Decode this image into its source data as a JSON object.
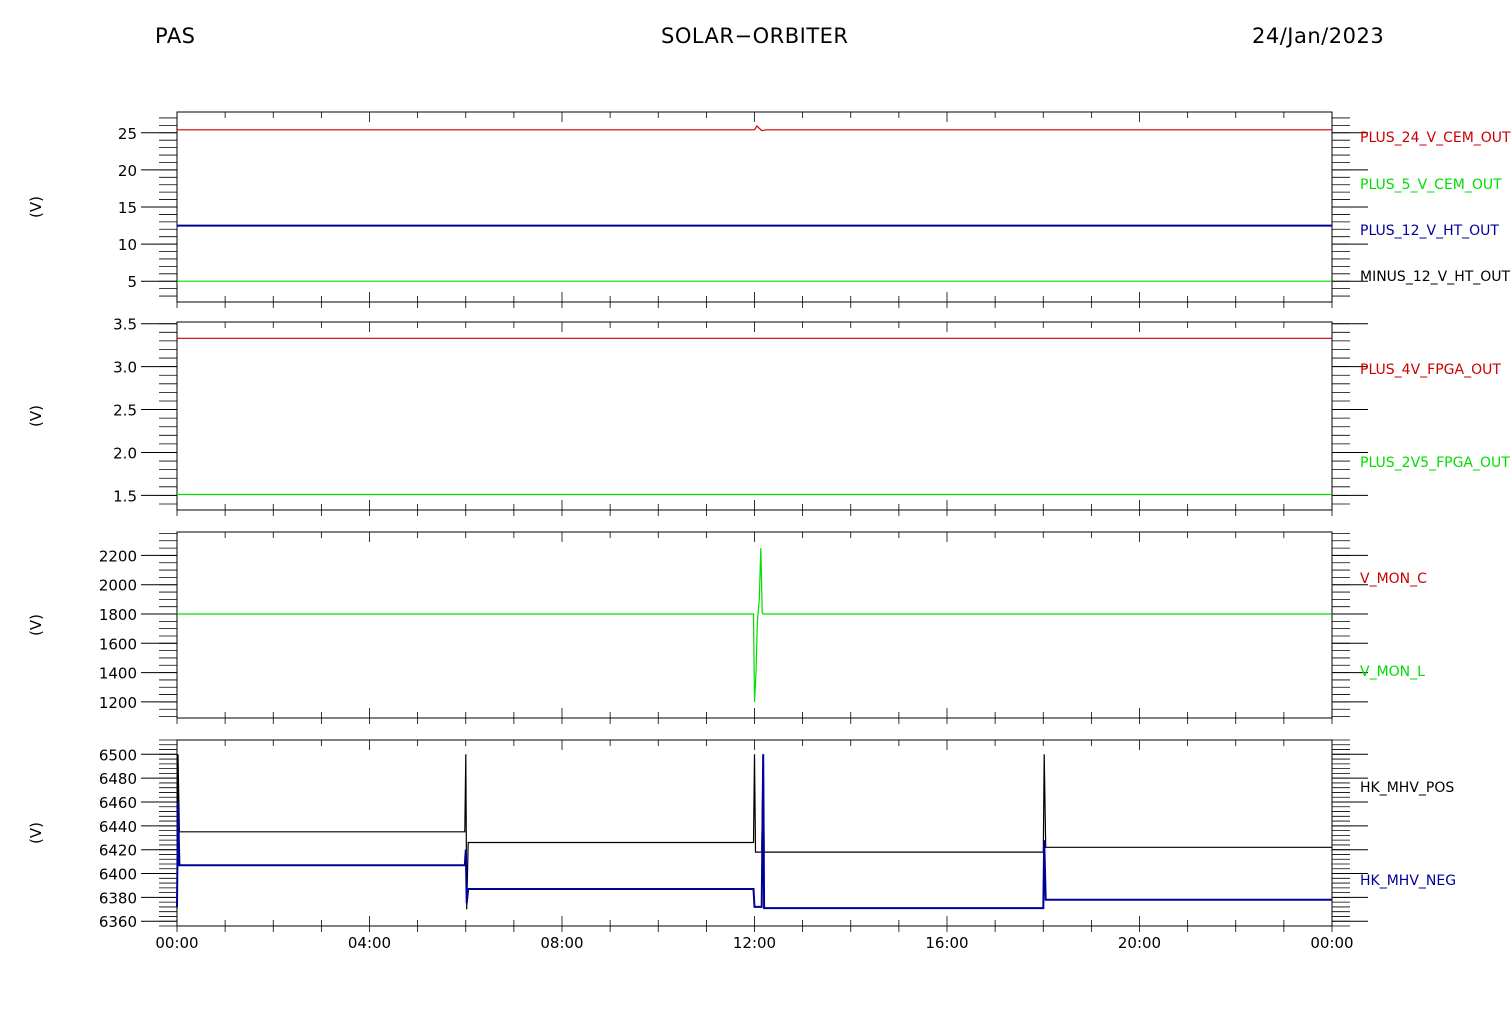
{
  "header": {
    "left": "PAS",
    "center": "SOLAR−ORBITER",
    "right": "24/Jan/2023"
  },
  "colors": {
    "red": "#cc0000",
    "green": "#00dd00",
    "blue": "#000099",
    "black": "#000000"
  },
  "chart_data": [
    {
      "type": "line",
      "ylabel": "(V)",
      "ylim": [
        2.2,
        27.8
      ],
      "yticks": [
        5,
        10,
        15,
        20,
        25
      ],
      "yminor": 1,
      "xlim": [
        0,
        24
      ],
      "series": [
        {
          "name": "PLUS_24_V_CEM_OUT",
          "color": "#cc0000",
          "x": [
            0,
            12.0,
            12.05,
            12.1,
            12.15,
            12.25,
            24
          ],
          "y": [
            25.4,
            25.4,
            25.9,
            25.6,
            25.3,
            25.4,
            25.4
          ]
        },
        {
          "name": "PLUS_5_V_CEM_OUT",
          "color": "#00dd00",
          "x": [
            0,
            24
          ],
          "y": [
            5.0,
            5.0
          ]
        },
        {
          "name": "PLUS_12_V_HT_OUT",
          "color": "#000099",
          "x": [
            0,
            24
          ],
          "y": [
            12.5,
            12.5
          ]
        },
        {
          "name": "MINUS_12_V_HT_OUT",
          "color": "#000000",
          "x": [],
          "y": []
        }
      ]
    },
    {
      "type": "line",
      "ylabel": "(V)",
      "ylim": [
        1.33,
        3.52
      ],
      "yticks": [
        1.5,
        2.0,
        2.5,
        3.0,
        3.5
      ],
      "yminor": 0.1,
      "xlim": [
        0,
        24
      ],
      "series": [
        {
          "name": "PLUS_4V_FPGA_OUT",
          "color": "#cc0000",
          "x": [
            0,
            24
          ],
          "y": [
            3.33,
            3.33
          ]
        },
        {
          "name": "PLUS_2V5_FPGA_OUT",
          "color": "#00dd00",
          "x": [
            0,
            24
          ],
          "y": [
            1.51,
            1.51
          ]
        }
      ]
    },
    {
      "type": "line",
      "ylabel": "(V)",
      "ylim": [
        1090,
        2360
      ],
      "yticks": [
        1200,
        1400,
        1600,
        1800,
        2000,
        2200
      ],
      "yminor": 50,
      "xlim": [
        0,
        24
      ],
      "series": [
        {
          "name": "V_MON_C",
          "color": "#cc0000",
          "x": [],
          "y": []
        },
        {
          "name": "V_MON_L",
          "color": "#00dd00",
          "x": [
            0,
            11.98,
            12.0,
            12.03,
            12.06,
            12.1,
            12.13,
            12.16,
            12.18,
            12.2,
            24
          ],
          "y": [
            1800,
            1800,
            1200,
            1380,
            1750,
            1900,
            2250,
            1810,
            1800,
            1800,
            1800
          ]
        }
      ]
    },
    {
      "type": "line",
      "ylabel": "(V)",
      "ylim": [
        6356,
        6512
      ],
      "yticks": [
        6360,
        6380,
        6400,
        6420,
        6440,
        6460,
        6480,
        6500
      ],
      "yminor": 4,
      "xlim": [
        0,
        24
      ],
      "xticks": [
        0,
        4,
        8,
        12,
        16,
        20,
        24
      ],
      "xticklabels": [
        "00:00",
        "04:00",
        "08:00",
        "12:00",
        "16:00",
        "20:00",
        "00:00"
      ],
      "series": [
        {
          "name": "HK_MHV_POS",
          "color": "#000000",
          "x": [
            0,
            0.02,
            0.05,
            0.1,
            5.98,
            6.0,
            6.02,
            6.05,
            6.1,
            11.98,
            12.0,
            12.02,
            12.05,
            12.1,
            12.15,
            12.18,
            12.2,
            17.95,
            18.0,
            18.02,
            18.05,
            18.1,
            24
          ],
          "y": [
            6370,
            6500,
            6435,
            6435,
            6435,
            6500,
            6370,
            6426,
            6426,
            6426,
            6500,
            6418,
            6418,
            6418,
            6418,
            6500,
            6418,
            6418,
            6418,
            6500,
            6422,
            6422,
            6422
          ]
        },
        {
          "name": "HK_MHV_NEG",
          "color": "#000099",
          "x": [
            0,
            0.02,
            0.05,
            0.1,
            5.98,
            6.0,
            6.02,
            6.05,
            6.1,
            11.98,
            12.0,
            12.02,
            12.05,
            12.15,
            12.18,
            12.2,
            17.95,
            18.0,
            18.02,
            18.05,
            24
          ],
          "y": [
            6372,
            6460,
            6407,
            6407,
            6407,
            6420,
            6375,
            6387,
            6387,
            6387,
            6372,
            6372,
            6372,
            6372,
            6500,
            6371,
            6371,
            6371,
            6428,
            6378,
            6378
          ]
        }
      ]
    }
  ]
}
